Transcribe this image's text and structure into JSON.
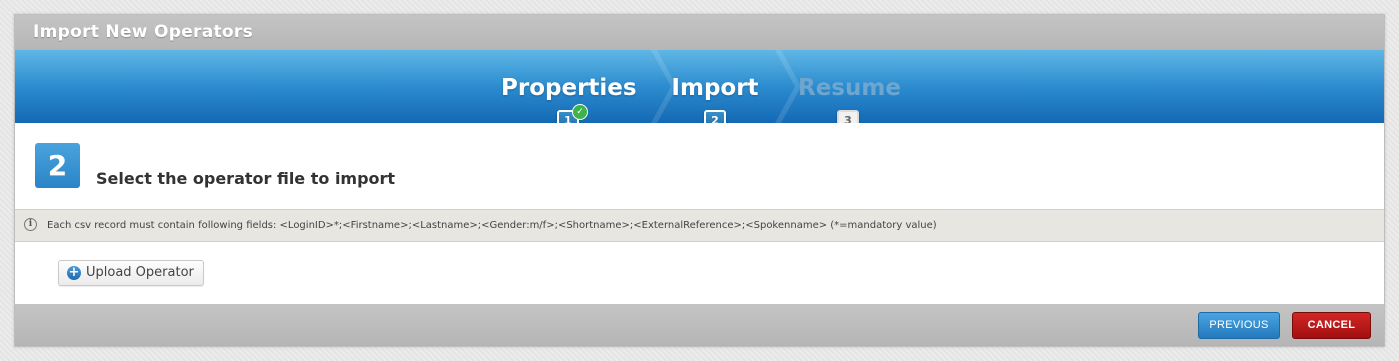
{
  "dialog": {
    "title": "Import New Operators"
  },
  "wizard": {
    "steps": [
      {
        "label": "Properties",
        "number": "1",
        "state": "completed",
        "check": "✓"
      },
      {
        "label": "Import",
        "number": "2",
        "state": "active"
      },
      {
        "label": "Resume",
        "number": "3",
        "state": "inactive"
      }
    ]
  },
  "content": {
    "step_number": "2",
    "heading": "Select the operator file to import",
    "info_icon": "i",
    "info_text": "Each csv record must contain following fields: <LoginID>*;<Firstname>;<Lastname>;<Gender:m/f>;<Shortname>;<ExternalReference>;<Spokenname> (*=mandatory value)",
    "upload_icon": "+",
    "upload_label": "Upload Operator"
  },
  "footer": {
    "previous_label": "PREVIOUS",
    "cancel_label": "CANCEL"
  },
  "colors": {
    "wizard_top": "#5fb7e6",
    "wizard_bottom": "#1469b4",
    "previous_button": "#2379bd",
    "cancel_button": "#a10f0f",
    "completed_check": "#3cb44b"
  }
}
